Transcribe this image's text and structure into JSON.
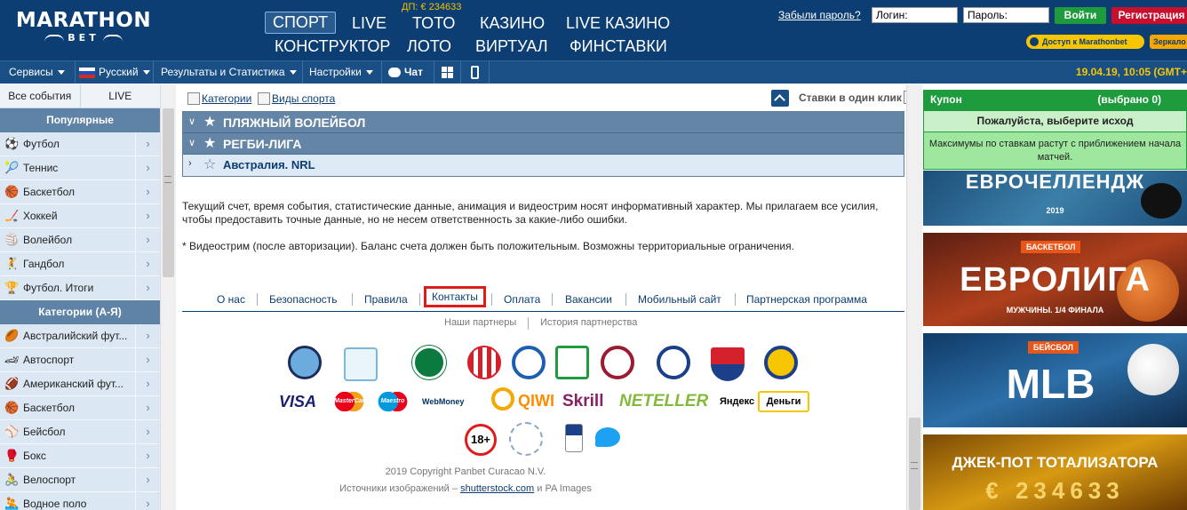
{
  "header": {
    "logo_main": "MARATHON",
    "logo_sub": "BET",
    "jackpot": "ДП: € 234633",
    "nav": [
      {
        "label": "СПОРТ",
        "active": true
      },
      {
        "label": "LIVE"
      },
      {
        "label": "ТОТО"
      },
      {
        "label": "КАЗИНО"
      },
      {
        "label": "LIVE КАЗИНО"
      },
      {
        "label": "КОНСТРУКТОР"
      },
      {
        "label": "ЛОТО"
      },
      {
        "label": "ВИРТУАЛ"
      },
      {
        "label": "ФИНСТАВКИ"
      }
    ],
    "forgot_password": "Забыли пароль?",
    "login_placeholder": "Логин:",
    "password_placeholder": "Пароль:",
    "login_button": "Войти",
    "register_button": "Регистрация",
    "access_pill": "Доступ к Marathonbet",
    "mirror_pill": "Зеркало"
  },
  "menubar": {
    "services": "Сервисы",
    "language": "Русский",
    "results": "Результаты и Статистика",
    "settings": "Настройки",
    "chat": "Чат",
    "datetime": "19.04.19, 10:05 (GMT+"
  },
  "sidebar": {
    "tab_all": "Все события",
    "tab_live": "LIVE",
    "popular_header": "Популярные",
    "popular": [
      {
        "label": "Футбол",
        "icon": "⚽"
      },
      {
        "label": "Теннис",
        "icon": "🎾"
      },
      {
        "label": "Баскетбол",
        "icon": "🏀"
      },
      {
        "label": "Хоккей",
        "icon": "🏒"
      },
      {
        "label": "Волейбол",
        "icon": "🏐"
      },
      {
        "label": "Гандбол",
        "icon": "🤾"
      },
      {
        "label": "Футбол. Итоги",
        "icon": "🏆"
      }
    ],
    "categories_header": "Категории (А-Я)",
    "categories": [
      {
        "label": "Австралийский фут...",
        "icon": "🏉"
      },
      {
        "label": "Автоспорт",
        "icon": "🏎"
      },
      {
        "label": "Американский фут...",
        "icon": "🏈"
      },
      {
        "label": "Баскетбол",
        "icon": "🏀"
      },
      {
        "label": "Бейсбол",
        "icon": "⚾"
      },
      {
        "label": "Бокс",
        "icon": "🥊"
      },
      {
        "label": "Велоспорт",
        "icon": "🚴"
      },
      {
        "label": "Водное поло",
        "icon": "🤽"
      }
    ]
  },
  "main": {
    "filter_categories": "Категории",
    "filter_sports": "Виды спорта",
    "oneclick": "Ставки в один клик",
    "rows": [
      {
        "name": "ПЛЯЖНЫЙ ВОЛЕЙБОЛ"
      },
      {
        "name": "РЕГБИ-ЛИГА"
      },
      {
        "name": "Австралия. NRL"
      }
    ],
    "disclaimer_1": "Текущий счет, время события, статистические данные, анимация и видеострим носят информативный характер. Мы прилагаем все усилия, чтобы предоставить точные данные, но не несем ответственность за какие-либо ошибки.",
    "disclaimer_2": "* Видеострим (после авторизации). Баланс счета должен быть положительным. Возможны территориальные ограничения.",
    "footer_links": [
      "О нас",
      "Безопасность",
      "Правила",
      "Контакты",
      "Оплата",
      "Вакансии",
      "Мобильный сайт",
      "Партнерская программа"
    ],
    "footer_sub": [
      "Наши партнеры",
      "История партнерства"
    ],
    "payments": [
      "VISA",
      "MasterCard",
      "Maestro",
      "WebMoney",
      "QIWI",
      "Skrill",
      "NETELLER",
      "Яндекс",
      "Деньги"
    ],
    "age": "18+",
    "copyright": "2019 Copyright Panbet Curacao N.V.",
    "sources_prefix": "Источники изображений –",
    "sources_link": "shutterstock.com",
    "sources_suffix": "и PA Images"
  },
  "coupon": {
    "title": "Купон",
    "count": "(выбрано 0)",
    "prompt": "Пожалуйста, выберите исход",
    "info": "Максимумы по ставкам растут с приближением началa матчей."
  },
  "banners": {
    "b1_title": "ЕВРОЧЕЛЛЕНДЖ",
    "b1_year": "2019",
    "b2_tag": "БАСКЕТБОЛ",
    "b2_title": "ЕВРОЛИГА",
    "b2_sub": "МУЖЧИНЫ. 1/4 ФИНАЛА",
    "b3_tag": "БЕЙСБОЛ",
    "b3_title": "MLB",
    "b4_title": "ДЖЕК-ПОТ ТОТАЛИЗАТОРА",
    "b4_value": "€ 234633"
  },
  "colors": {
    "header_bg": "#0c3d73",
    "accent_yellow": "#f7c600",
    "coupon_green": "#1e9b3c",
    "highlight_red": "#e01b1b"
  }
}
